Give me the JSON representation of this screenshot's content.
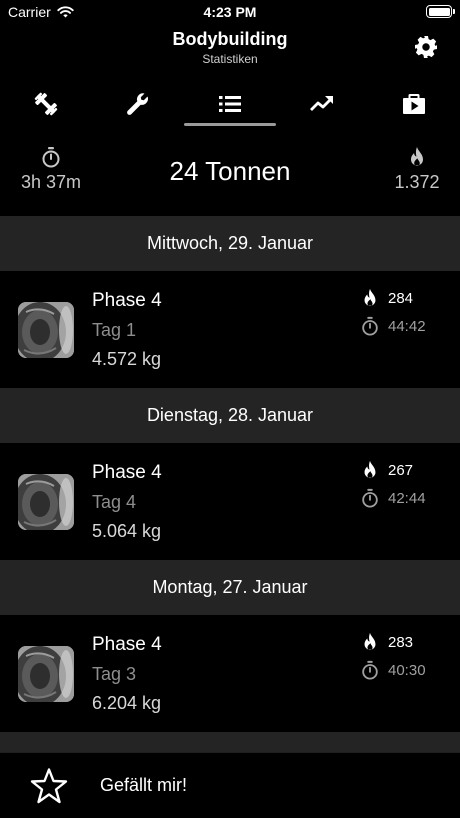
{
  "status_bar": {
    "carrier": "Carrier",
    "time": "4:23 PM"
  },
  "header": {
    "title": "Bodybuilding",
    "subtitle": "Statistiken",
    "settings_icon": "gear-icon"
  },
  "tabs": [
    {
      "icon": "dumbbell-icon",
      "selected": false
    },
    {
      "icon": "wrench-icon",
      "selected": false
    },
    {
      "icon": "list-icon",
      "selected": true
    },
    {
      "icon": "trend-up-icon",
      "selected": false
    },
    {
      "icon": "video-briefcase-icon",
      "selected": false
    }
  ],
  "summary": {
    "duration": "3h 37m",
    "total": "24 Tonnen",
    "calories": "1.372"
  },
  "sessions": [
    {
      "date": "Mittwoch, 29. Januar",
      "title": "Phase 4",
      "day": "Tag 1",
      "weight": "4.572 kg",
      "calories": "284",
      "time": "44:42"
    },
    {
      "date": "Dienstag, 28. Januar",
      "title": "Phase 4",
      "day": "Tag 4",
      "weight": "5.064 kg",
      "calories": "267",
      "time": "42:44"
    },
    {
      "date": "Montag, 27. Januar",
      "title": "Phase 4",
      "day": "Tag 3",
      "weight": "6.204 kg",
      "calories": "283",
      "time": "40:30"
    }
  ],
  "bottom": {
    "like_label": "Gefällt mir!"
  },
  "colors": {
    "background": "#000000",
    "section_header": "#242424",
    "secondary_text": "#8e8e8e",
    "tab_indicator": "#9a9a9a"
  }
}
